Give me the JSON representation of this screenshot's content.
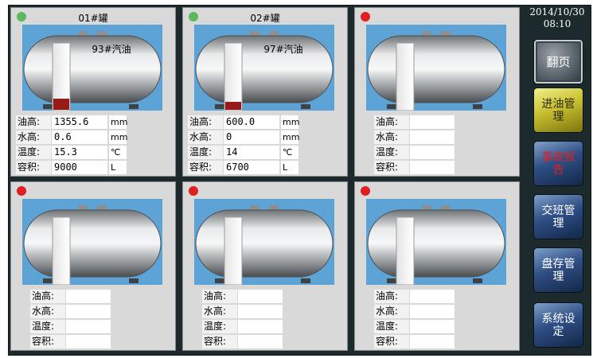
{
  "clock": {
    "date": "2014/10/30",
    "time": "08:10"
  },
  "colors": {
    "status_green": "#5cb85c",
    "status_red": "#e02020",
    "oil_fill": "#9a1a1a",
    "alarm_text": "#e02020"
  },
  "tanks": [
    {
      "title": "01#罐",
      "status": "green",
      "product": "93#汽油",
      "fill_fraction": 0.2,
      "rows": [
        {
          "label": "油高:",
          "value": "1355.6",
          "unit": "mm"
        },
        {
          "label": "水高:",
          "value": "0.6",
          "unit": "mm"
        },
        {
          "label": "温度:",
          "value": "15.3",
          "unit": "℃"
        },
        {
          "label": "容积:",
          "value": "9000",
          "unit": "L"
        }
      ]
    },
    {
      "title": "02#罐",
      "status": "green",
      "product": "97#汽油",
      "fill_fraction": 0.15,
      "rows": [
        {
          "label": "油高:",
          "value": "600.0",
          "unit": "mm"
        },
        {
          "label": "水高:",
          "value": "0",
          "unit": "mm"
        },
        {
          "label": "温度:",
          "value": "14",
          "unit": "℃"
        },
        {
          "label": "容积:",
          "value": "6700",
          "unit": "L"
        }
      ]
    },
    {
      "title": "",
      "status": "red",
      "product": "",
      "fill_fraction": 0,
      "rows": [
        {
          "label": "油高:",
          "value": "",
          "unit": ""
        },
        {
          "label": "水高:",
          "value": "",
          "unit": ""
        },
        {
          "label": "温度:",
          "value": "",
          "unit": ""
        },
        {
          "label": "容积:",
          "value": "",
          "unit": ""
        }
      ]
    },
    {
      "title": "",
      "status": "red",
      "product": "",
      "fill_fraction": 0,
      "rows": [
        {
          "label": "油高:",
          "value": "",
          "unit": ""
        },
        {
          "label": "水高:",
          "value": "",
          "unit": ""
        },
        {
          "label": "温度:",
          "value": "",
          "unit": ""
        },
        {
          "label": "容积:",
          "value": "",
          "unit": ""
        }
      ]
    },
    {
      "title": "",
      "status": "red",
      "product": "",
      "fill_fraction": 0,
      "rows": [
        {
          "label": "油高:",
          "value": "",
          "unit": ""
        },
        {
          "label": "水高:",
          "value": "",
          "unit": ""
        },
        {
          "label": "温度:",
          "value": "",
          "unit": ""
        },
        {
          "label": "容积:",
          "value": "",
          "unit": ""
        }
      ]
    },
    {
      "title": "",
      "status": "red",
      "product": "",
      "fill_fraction": 0,
      "rows": [
        {
          "label": "油高:",
          "value": "",
          "unit": ""
        },
        {
          "label": "水高:",
          "value": "",
          "unit": ""
        },
        {
          "label": "温度:",
          "value": "",
          "unit": ""
        },
        {
          "label": "容积:",
          "value": "",
          "unit": ""
        }
      ]
    }
  ],
  "side_buttons": [
    {
      "label": "翻页"
    },
    {
      "label": "进油管理"
    },
    {
      "label": "事故报告"
    },
    {
      "label": "交班管理"
    },
    {
      "label": "盘存管理"
    },
    {
      "label": "系统设定"
    }
  ]
}
